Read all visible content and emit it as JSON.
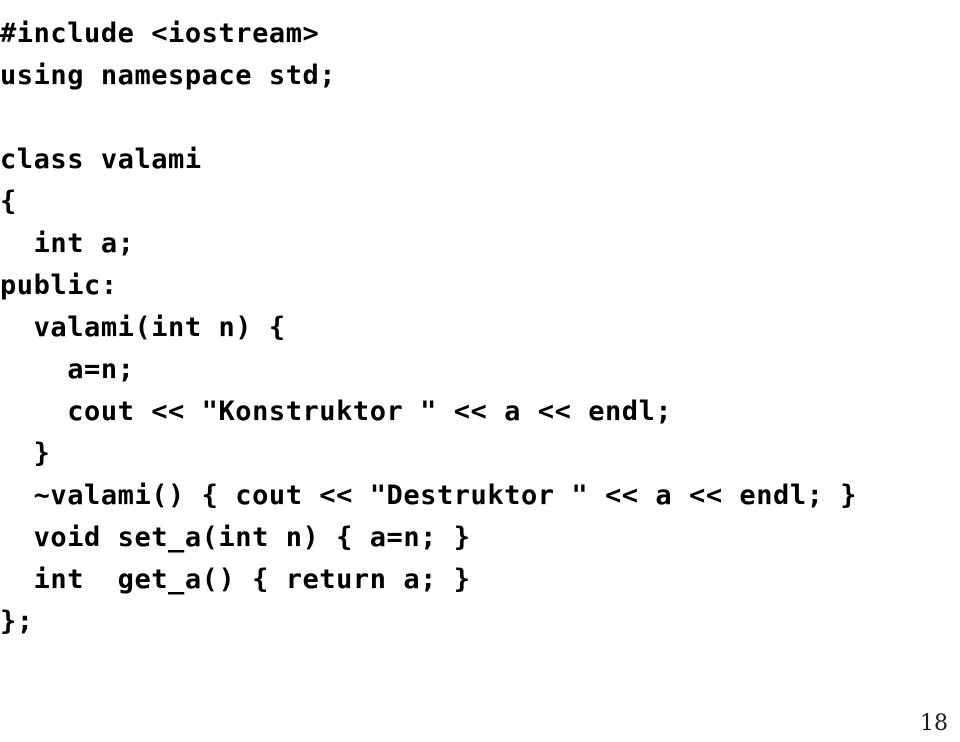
{
  "slide": {
    "background_color": "#ffffff",
    "text_color": "#000000",
    "page_number": "18",
    "language": "C++"
  },
  "code": {
    "lines": [
      {
        "text": "#include <iostream>",
        "indent": 0,
        "blank": false
      },
      {
        "text": "using namespace std;",
        "indent": 0,
        "blank": false
      },
      {
        "text": "",
        "indent": 0,
        "blank": true
      },
      {
        "text": "class valami",
        "indent": 0,
        "blank": false
      },
      {
        "text": "{",
        "indent": 0,
        "blank": false
      },
      {
        "text": "  int a;",
        "indent": 2,
        "blank": false
      },
      {
        "text": "public:",
        "indent": 0,
        "blank": false
      },
      {
        "text": "  valami(int n) {",
        "indent": 2,
        "blank": false
      },
      {
        "text": "    a=n;",
        "indent": 4,
        "blank": false
      },
      {
        "text": "    cout << \"Konstruktor \" << a << endl;",
        "indent": 4,
        "blank": false
      },
      {
        "text": "  }",
        "indent": 2,
        "blank": false
      },
      {
        "text": "  ~valami() { cout << \"Destruktor \" << a << endl; }",
        "indent": 2,
        "blank": false
      },
      {
        "text": "  void set_a(int n) { a=n; }",
        "indent": 2,
        "blank": false
      },
      {
        "text": "  int  get_a() { return a; }",
        "indent": 2,
        "blank": false
      },
      {
        "text": "};",
        "indent": 0,
        "blank": false
      }
    ]
  }
}
